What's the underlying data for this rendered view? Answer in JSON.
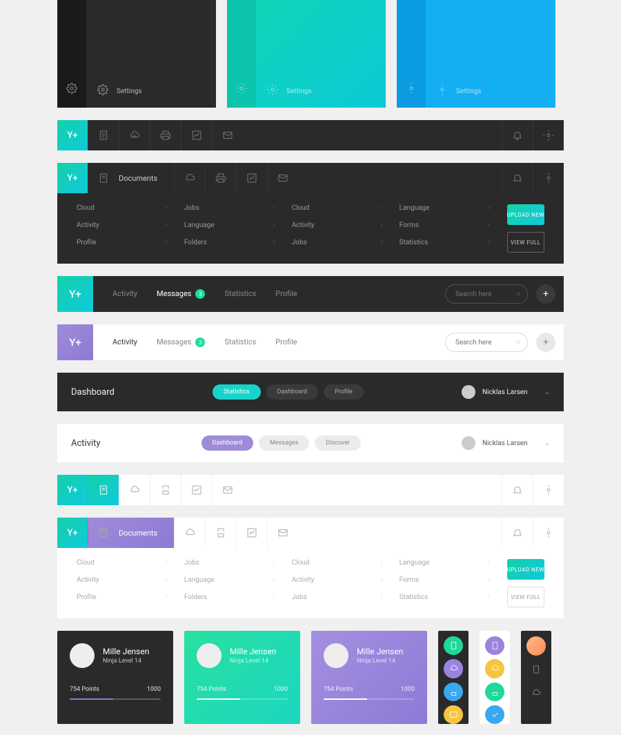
{
  "sidebarPreviews": {
    "settingsLabel": "Settings"
  },
  "topbars": {
    "logo": "Y+",
    "documentsLabel": "Documents"
  },
  "navLinks": {
    "col1": [
      "Cloud",
      "Activity",
      "Profile"
    ],
    "col2": [
      "Jobs",
      "Language",
      "Folders"
    ],
    "col3": [
      "Cloud",
      "Activity",
      "Jobs"
    ],
    "col4": [
      "Language",
      "Forms",
      "Statistics"
    ]
  },
  "buttons": {
    "uploadNew": "UPLOAD NEW",
    "viewFull": "VIEW FULL"
  },
  "tabbars": {
    "tabs": [
      "Activity",
      "Messages",
      "Statistics",
      "Profile"
    ],
    "badgeCount": "3",
    "searchPlaceholder": "Search here",
    "plus": "+"
  },
  "dashRows": {
    "darkTitle": "Dashboard",
    "darkPills": [
      "Statistics",
      "Dashboard",
      "Profile"
    ],
    "lightTitle": "Activity",
    "lightPills": [
      "Dashboard",
      "Messages",
      "Discover"
    ],
    "userName": "Nicklas Larsen"
  },
  "profileCard": {
    "name": "Mille Jensen",
    "subtitle": "Ninja Level 14",
    "points": "754 Points",
    "max": "1000"
  }
}
